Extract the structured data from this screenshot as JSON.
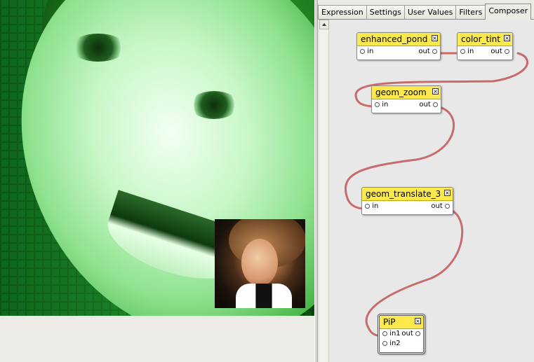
{
  "tabs": [
    {
      "label": "Expression",
      "active": false
    },
    {
      "label": "Settings",
      "active": false
    },
    {
      "label": "User Values",
      "active": false
    },
    {
      "label": "Filters",
      "active": false
    },
    {
      "label": "Composer",
      "active": true
    }
  ],
  "nodes": {
    "enhanced_pond": {
      "title": "enhanced_pond",
      "in": "in",
      "out": "out"
    },
    "color_tint": {
      "title": "color_tint",
      "in": "in",
      "out": "out"
    },
    "geom_zoom": {
      "title": "geom_zoom",
      "in": "in",
      "out": "out"
    },
    "geom_translate_3": {
      "title": "geom_translate_3",
      "in": "in",
      "out": "out"
    },
    "pip": {
      "title": "PiP",
      "in1": "in1",
      "in2": "in2",
      "out": "out"
    }
  },
  "connections": [
    [
      "enhanced_pond.out",
      "color_tint.in"
    ],
    [
      "color_tint.out",
      "geom_zoom.in"
    ],
    [
      "geom_zoom.out",
      "geom_translate_3.in"
    ],
    [
      "geom_translate_3.out",
      "pip.in1"
    ]
  ],
  "icons": {
    "close": "close-icon",
    "scroll_up": "arrow-up-icon"
  },
  "colors": {
    "node_title": "#fbe94e",
    "wire": "#c96b6b",
    "canvas": "#e8e8e8",
    "preview_tint": "#3fd13f"
  }
}
